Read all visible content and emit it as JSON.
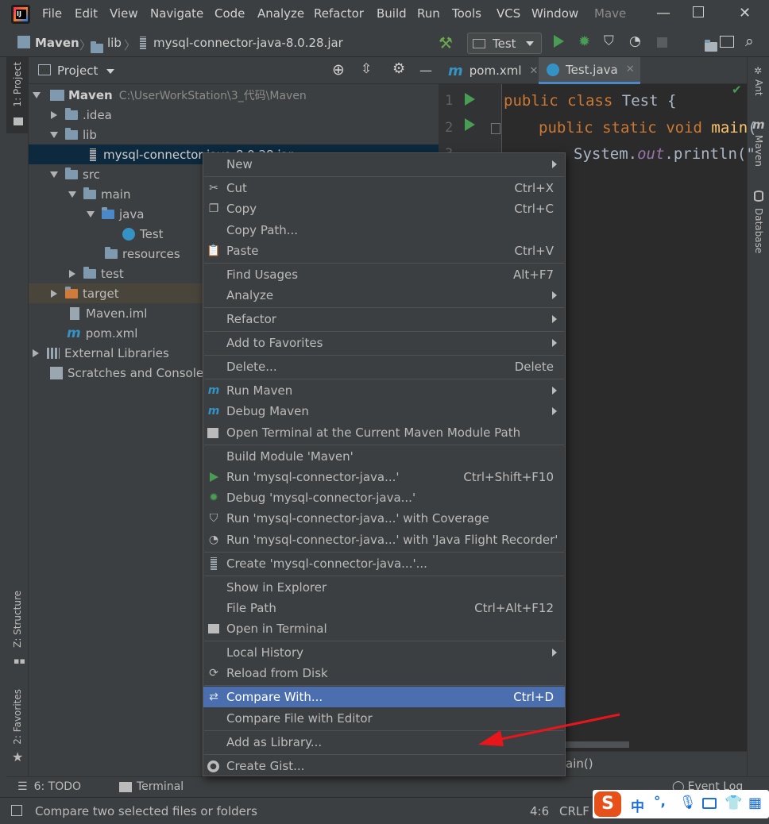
{
  "menubar": {
    "items": [
      "File",
      "Edit",
      "View",
      "Navigate",
      "Code",
      "Analyze",
      "Refactor",
      "Build",
      "Run",
      "Tools",
      "VCS",
      "Window",
      "Mave"
    ]
  },
  "navbar": {
    "crumbs": [
      "Maven",
      "lib",
      "mysql-connector-java-8.0.28.jar"
    ],
    "run_config": "Test"
  },
  "left_stripe": {
    "project": "1: Project",
    "structure": "Z: Structure",
    "favorites": "2: Favorites"
  },
  "right_stripe": {
    "ant": "Ant",
    "maven": "Maven",
    "database": "Database"
  },
  "project_panel": {
    "title": "Project",
    "tree": [
      {
        "label": "Maven",
        "extra": "C:\\UserWorkStation\\3_代码\\Maven"
      },
      {
        "label": ".idea"
      },
      {
        "label": "lib"
      },
      {
        "label": "mysql-connector-java-8.0.28.jar"
      },
      {
        "label": "src"
      },
      {
        "label": "main"
      },
      {
        "label": "java"
      },
      {
        "label": "Test"
      },
      {
        "label": "resources"
      },
      {
        "label": "test"
      },
      {
        "label": "target"
      },
      {
        "label": "Maven.iml"
      },
      {
        "label": "pom.xml"
      },
      {
        "label": "External Libraries"
      },
      {
        "label": "Scratches and Consoles"
      }
    ]
  },
  "editor": {
    "tabs": [
      "pom.xml",
      "Test.java"
    ],
    "line_numbers": [
      "1",
      "2",
      "3"
    ],
    "line1": {
      "kw1": "public",
      "kw2": "class",
      "name": "Test",
      "brace": "{"
    },
    "line2": {
      "kw1": "public",
      "kw2": "static",
      "kw3": "void",
      "fn": "main",
      "rest": "("
    },
    "line3": {
      "obj": "System.",
      "field": "out",
      "rest": ".println(\""
    },
    "breadcrumb": "ain()"
  },
  "context_menu": {
    "items": [
      {
        "label": "New",
        "shortcut": "",
        "submenu": true
      },
      {
        "label": "Cut",
        "shortcut": "Ctrl+X",
        "icon": "scissors-icon"
      },
      {
        "label": "Copy",
        "shortcut": "Ctrl+C",
        "icon": "copy-icon"
      },
      {
        "label": "Copy Path...",
        "shortcut": ""
      },
      {
        "label": "Paste",
        "shortcut": "Ctrl+V",
        "icon": "clipboard-icon"
      },
      {
        "label": "Find Usages",
        "shortcut": "Alt+F7"
      },
      {
        "label": "Analyze",
        "shortcut": "",
        "submenu": true
      },
      {
        "label": "Refactor",
        "shortcut": "",
        "submenu": true
      },
      {
        "label": "Add to Favorites",
        "shortcut": "",
        "submenu": true
      },
      {
        "label": "Delete...",
        "shortcut": "Delete"
      },
      {
        "label": "Run Maven",
        "shortcut": "",
        "submenu": true,
        "icon": "maven-run-icon"
      },
      {
        "label": "Debug Maven",
        "shortcut": "",
        "submenu": true,
        "icon": "maven-debug-icon"
      },
      {
        "label": "Open Terminal at the Current Maven Module Path",
        "shortcut": "",
        "icon": "maven-terminal-icon"
      },
      {
        "label": "Build Module 'Maven'",
        "shortcut": ""
      },
      {
        "label": "Run 'mysql-connector-java...'",
        "shortcut": "Ctrl+Shift+F10",
        "icon": "run-icon"
      },
      {
        "label": "Debug 'mysql-connector-java...'",
        "shortcut": "",
        "icon": "debug-icon"
      },
      {
        "label": "Run 'mysql-connector-java...' with Coverage",
        "shortcut": "",
        "icon": "coverage-icon"
      },
      {
        "label": "Run 'mysql-connector-java...' with 'Java Flight Recorder'",
        "shortcut": "",
        "icon": "profiler-icon"
      },
      {
        "label": "Create 'mysql-connector-java...'...",
        "shortcut": "",
        "icon": "jar-icon"
      },
      {
        "label": "Show in Explorer",
        "shortcut": ""
      },
      {
        "label": "File Path",
        "shortcut": "Ctrl+Alt+F12"
      },
      {
        "label": "Open in Terminal",
        "shortcut": "",
        "icon": "terminal-icon"
      },
      {
        "label": "Local History",
        "shortcut": "",
        "submenu": true
      },
      {
        "label": "Reload from Disk",
        "shortcut": "",
        "icon": "reload-icon"
      },
      {
        "label": "Compare With...",
        "shortcut": "Ctrl+D",
        "icon": "compare-icon"
      },
      {
        "label": "Compare File with Editor",
        "shortcut": ""
      },
      {
        "label": "Add as Library...",
        "shortcut": ""
      },
      {
        "label": "Create Gist...",
        "shortcut": "",
        "icon": "github-icon"
      }
    ]
  },
  "bottom_tools": {
    "todo": "6: TODO",
    "terminal": "Terminal",
    "event_log": "Event Log"
  },
  "status": {
    "message": "Compare two selected files or folders",
    "position": "4:6",
    "line_sep": "CRLF"
  },
  "ime": {
    "mode": "中"
  },
  "colors": {
    "selection": "#4b6eaf",
    "arrow": "#e8161b",
    "run_green": "#499c54"
  }
}
